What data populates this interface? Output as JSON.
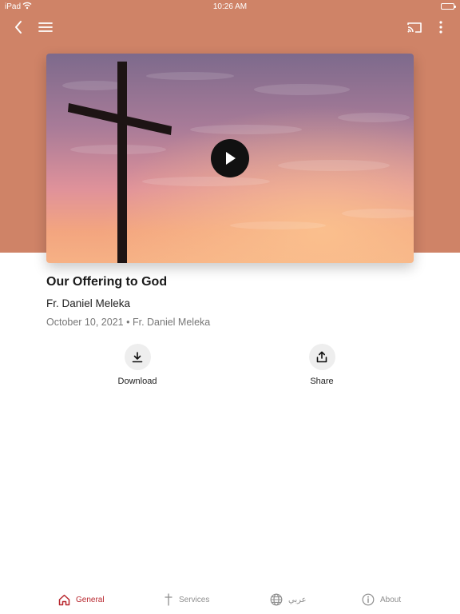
{
  "status_bar": {
    "device": "iPad",
    "time": "10:26 AM"
  },
  "colors": {
    "header_background": "#cf8367",
    "accent": "#b8262d",
    "inactive_tab": "#8e8e8e"
  },
  "video": {
    "title": "Our Offering to God",
    "author": "Fr. Daniel Meleka",
    "date": "October 10, 2021",
    "separator": "•",
    "meta_author": "Fr. Daniel Meleka",
    "thumbnail_icon": "cross-at-sunset"
  },
  "actions": {
    "download_label": "Download",
    "share_label": "Share"
  },
  "tabs": [
    {
      "label": "General",
      "icon": "home-icon",
      "active": true
    },
    {
      "label": "Services",
      "icon": "cross-icon",
      "active": false
    },
    {
      "label": "عربي",
      "icon": "globe-icon",
      "active": false
    },
    {
      "label": "About",
      "icon": "info-icon",
      "active": false
    }
  ]
}
